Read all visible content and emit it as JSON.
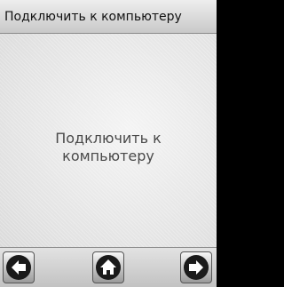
{
  "header": {
    "title": "Подключить к компьютеру"
  },
  "main": {
    "message_line1": "Подключить к",
    "message_line2": "компьютеру"
  },
  "nav": {
    "back_icon": "arrow-left-icon",
    "home_icon": "house-icon",
    "forward_icon": "arrow-right-icon"
  }
}
